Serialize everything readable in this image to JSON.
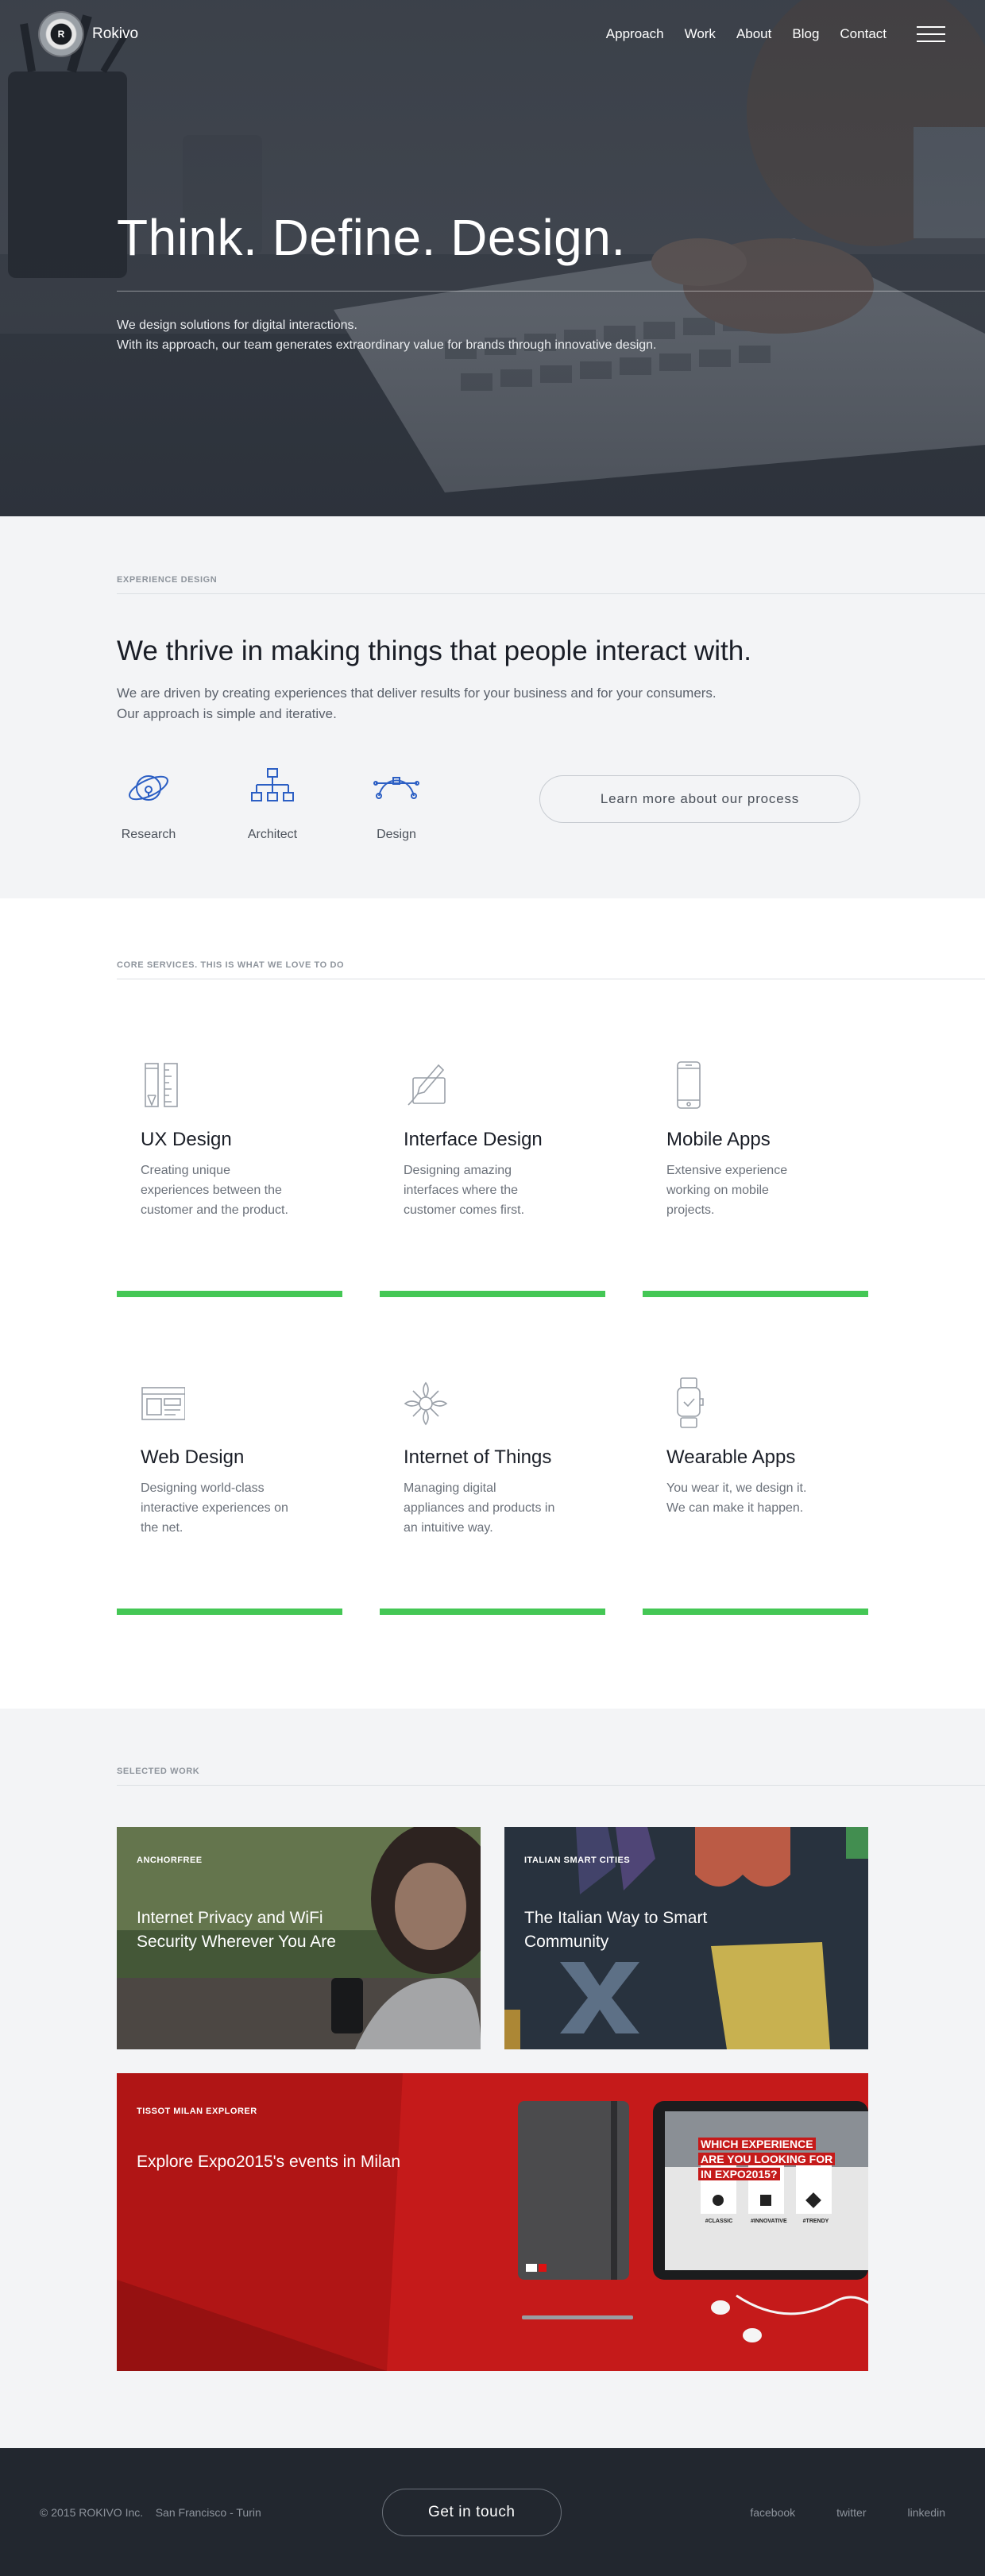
{
  "nav": {
    "brand": "Rokivo",
    "logo_letter": "R",
    "links": [
      "Approach",
      "Work",
      "About",
      "Blog",
      "Contact"
    ],
    "menu_icon": "hamburger-icon"
  },
  "hero": {
    "title": "Think. Define. Design.",
    "line1": "We design solutions for digital interactions.",
    "line2": "With its approach, our team generates extraordinary value for brands through innovative design."
  },
  "experience": {
    "label": "EXPERIENCE DESIGN",
    "title": "We thrive in making things that people interact with.",
    "desc1": "We are driven by creating experiences that deliver results for your business and for your consumers.",
    "desc2": "Our approach is simple and iterative.",
    "icons": [
      {
        "label": "Research",
        "icon": "research-icon"
      },
      {
        "label": "Architect",
        "icon": "architect-icon"
      },
      {
        "label": "Design",
        "icon": "design-icon"
      }
    ],
    "cta": "Learn more about our process",
    "accent": "#2c5fc4"
  },
  "services": {
    "label": "CORE SERVICES. THIS IS WHAT WE LOVE TO DO",
    "accent": "#44c755",
    "items": [
      {
        "title": "UX Design",
        "line1": "Creating unique",
        "line2": "experiences between the",
        "line3": "customer and the product.",
        "icon": "ux-tools-icon"
      },
      {
        "title": "Interface Design",
        "line1": "Designing amazing",
        "line2": "interfaces where the",
        "line3": "customer comes first.",
        "icon": "pen-tablet-icon"
      },
      {
        "title": "Mobile Apps",
        "line1": "Extensive experience",
        "line2": "working on mobile",
        "line3": "projects.",
        "icon": "smartphone-icon"
      },
      {
        "title": "Web Design",
        "line1": "Designing world-class",
        "line2": "interactive experiences on",
        "line3": "the net.",
        "icon": "browser-window-icon"
      },
      {
        "title": "Internet of Things",
        "line1": "Managing digital",
        "line2": "appliances and products in",
        "line3": "an intuitive way.",
        "icon": "connected-devices-icon"
      },
      {
        "title": "Wearable Apps",
        "line1": "You wear it, we design it.",
        "line2": "We can make it happen.",
        "line3": "",
        "icon": "smartwatch-icon"
      }
    ]
  },
  "work": {
    "label": "SELECTED WORK",
    "projects": [
      {
        "client": "ANCHORFREE",
        "title": "Internet Privacy and WiFi Security Wherever You Are"
      },
      {
        "client": "ITALIAN SMART CITIES",
        "title": "The Italian Way to Smart Community"
      },
      {
        "client": "TISSOT MILAN EXPLORER",
        "title": "Explore Expo2015's events in Milan"
      }
    ],
    "tablet_line1": "WHICH EXPERIENCE",
    "tablet_line2": "ARE YOU LOOKING FOR",
    "tablet_line3": "IN EXPO2015?",
    "tablet_tags": [
      "#CLASSIC",
      "#INNOVATIVE",
      "#TRENDY"
    ]
  },
  "footer": {
    "copyright": "© 2015 ROKIVO Inc.",
    "location": "San Francisco - Turin",
    "cta": "Get in touch",
    "social": [
      "facebook",
      "twitter",
      "linkedin"
    ]
  }
}
